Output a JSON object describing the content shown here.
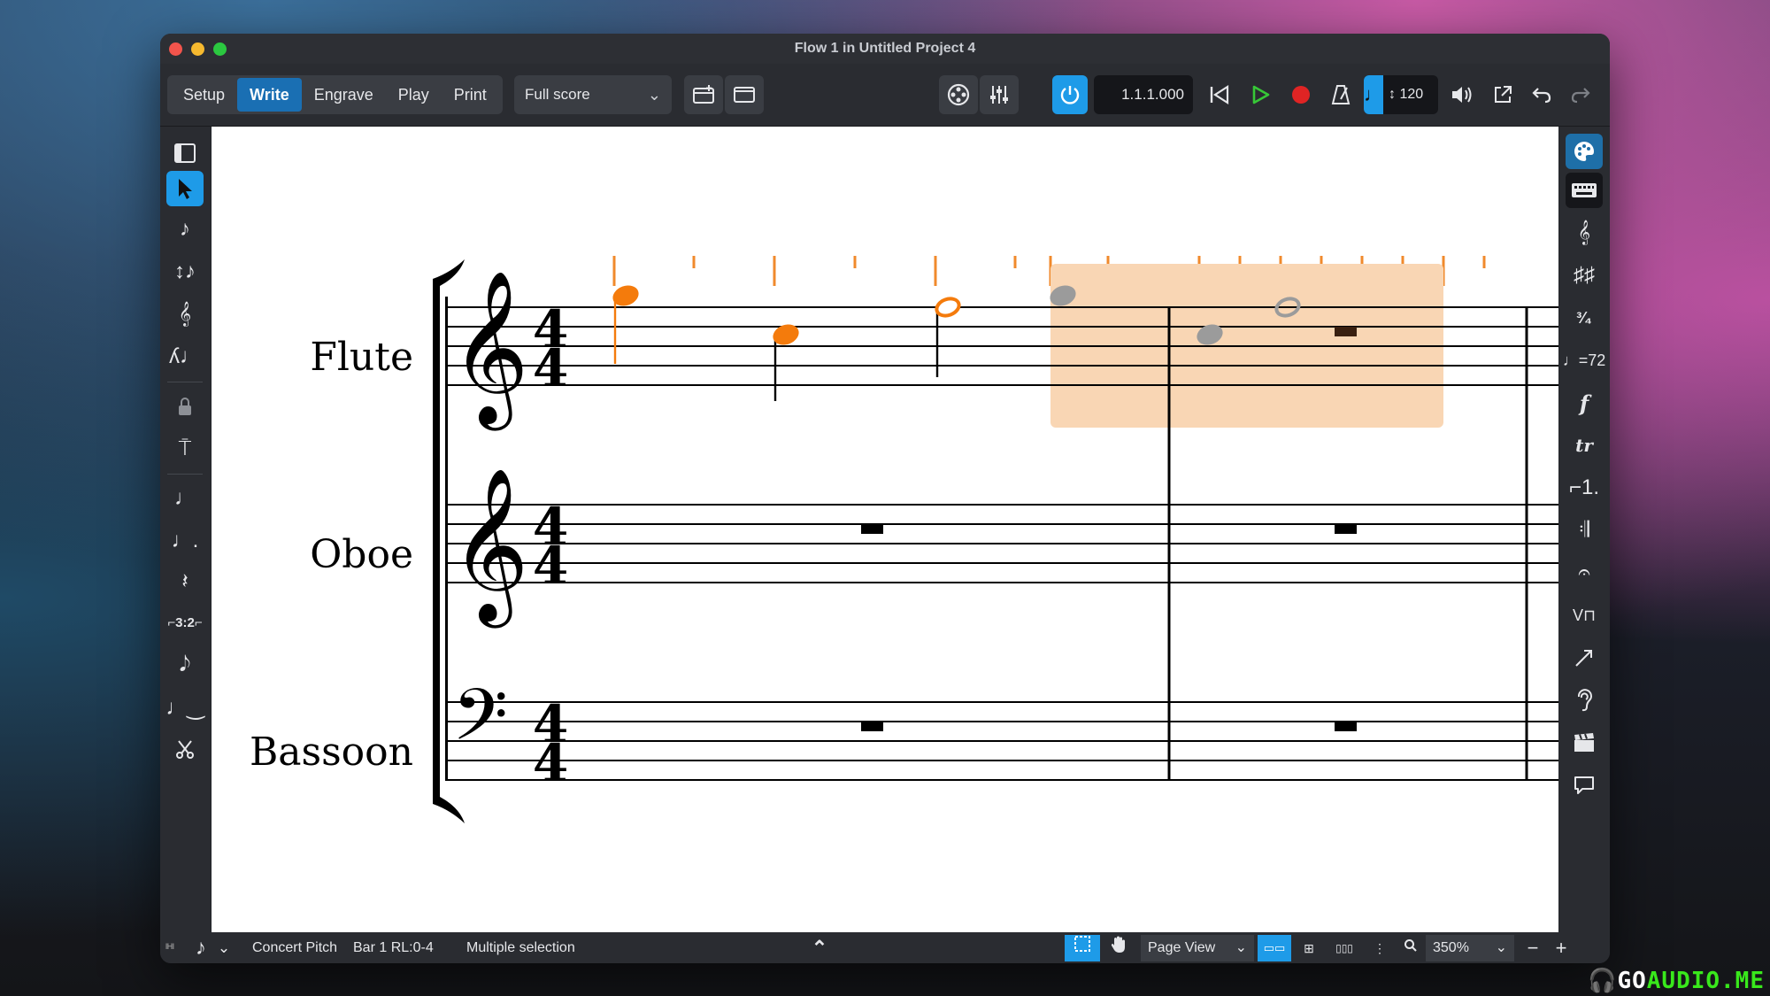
{
  "window": {
    "title": "Flow 1 in Untitled Project 4"
  },
  "toolbar": {
    "tabs": [
      "Setup",
      "Write",
      "Engrave",
      "Play",
      "Print"
    ],
    "active_tab": "Write",
    "layout": "Full score",
    "position": "1.1.1.000",
    "tempo": "120"
  },
  "score": {
    "instruments": [
      "Flute",
      "Oboe",
      "Bassoon"
    ],
    "time_signature": "4/4",
    "selection_color": "#f9d6b4",
    "note_color": "#f47b0c"
  },
  "status": {
    "pitch": "Concert Pitch",
    "bar": "Bar 1 RL:0-4",
    "selection": "Multiple selection",
    "view": "Page View",
    "zoom": "350%"
  },
  "colors": {
    "accent": "#1e9be8",
    "active_tab": "#1a6fb3",
    "play": "#37c837",
    "record": "#e02424"
  },
  "watermark": {
    "prefix": "GO",
    "suffix": "AUDIO.ME"
  }
}
